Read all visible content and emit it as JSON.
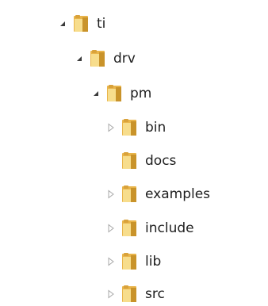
{
  "tree": {
    "colors": {
      "expanded_arrow": "#3b3b3b",
      "collapsed_arrow": "#a8a8a8",
      "folder_base": "#e9b54b",
      "folder_light": "#f7dd8c",
      "folder_shadow": "#c9932a"
    },
    "nodes": [
      {
        "label": "ti",
        "state": "expanded",
        "icon": "folder-icon"
      },
      {
        "label": "drv",
        "state": "expanded",
        "icon": "folder-icon"
      },
      {
        "label": "pm",
        "state": "expanded",
        "icon": "folder-icon"
      },
      {
        "label": "bin",
        "state": "collapsed",
        "icon": "folder-icon"
      },
      {
        "label": "docs",
        "state": "leaf",
        "icon": "folder-icon"
      },
      {
        "label": "examples",
        "state": "collapsed",
        "icon": "folder-icon"
      },
      {
        "label": "include",
        "state": "collapsed",
        "icon": "folder-icon"
      },
      {
        "label": "lib",
        "state": "collapsed",
        "icon": "folder-icon"
      },
      {
        "label": "src",
        "state": "collapsed",
        "icon": "folder-icon"
      }
    ]
  }
}
